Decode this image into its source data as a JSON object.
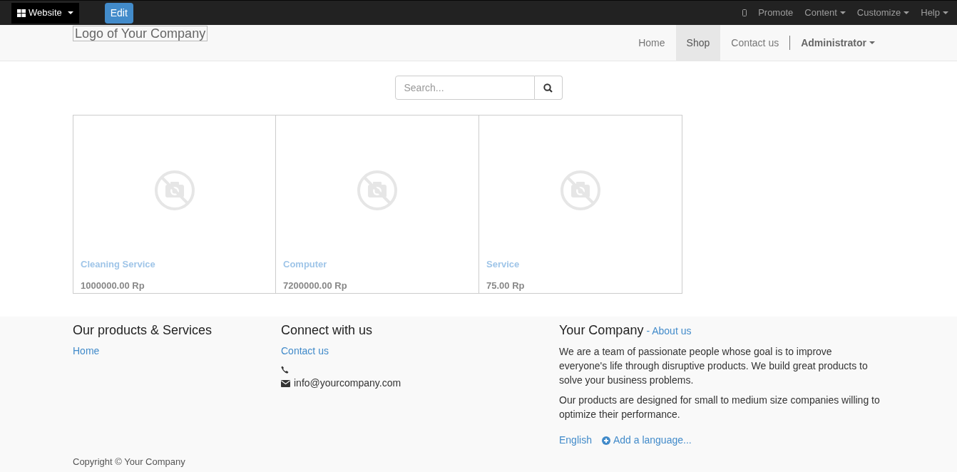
{
  "top_bar": {
    "website_menu": "Website",
    "edit_button": "Edit",
    "items": [
      {
        "kind": "icon"
      },
      {
        "kind": "link",
        "label": "Promote"
      },
      {
        "kind": "dropdown",
        "label": "Content"
      },
      {
        "kind": "dropdown",
        "label": "Customize"
      },
      {
        "kind": "dropdown",
        "label": "Help"
      }
    ]
  },
  "header": {
    "logo_alt": "Logo of Your Company",
    "nav": [
      {
        "label": "Home",
        "selected": false
      },
      {
        "label": "Shop",
        "selected": true
      },
      {
        "label": "Contact us",
        "selected": false
      }
    ],
    "user": "Administrator"
  },
  "search": {
    "placeholder": "Search..."
  },
  "products": [
    {
      "name": "Cleaning Service",
      "price": "1000000.00 Rp"
    },
    {
      "name": "Computer",
      "price": "7200000.00 Rp"
    },
    {
      "name": "Service",
      "price": "75.00 Rp"
    }
  ],
  "footer": {
    "products_title": "Our products & Services",
    "products_links": [
      "Home"
    ],
    "connect_title": "Connect with us",
    "connect_link": "Contact us",
    "email": "info@yourcompany.com",
    "company_title": "Your Company",
    "about_link": "- About us",
    "paragraphs": [
      "We are a team of passionate people whose goal is to improve everyone's life through disruptive products. We build great products to solve your business problems.",
      "Our products are designed for small to medium size companies willing to optimize their performance."
    ],
    "language": "English",
    "add_language": "Add a language...",
    "copyright": "Copyright © Your Company"
  }
}
